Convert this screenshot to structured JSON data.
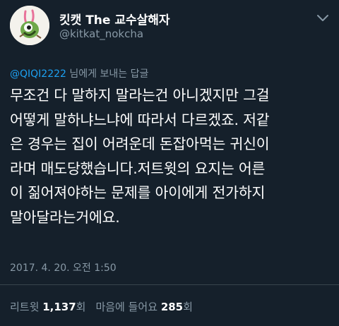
{
  "author": {
    "display_name": "킷캣 The 교수살해자",
    "handle": "@kitkat_nokcha",
    "avatar_icon": "bird-avatar"
  },
  "reply": {
    "mention": "@QIQI2222",
    "suffix": " 님에게 보내는 답글"
  },
  "tweet": {
    "text": "무조건 다 말하지 말라는건 아니겠지만 그걸\n어떻게 말하냐느냐에 따라서 다르겠죠. 저같\n은 경우는 집이 어려운데 돈잡아먹는 귀신이\n라며 매도당했습니다.저트윗의 요지는 어른\n이 짊어져야하는 문제를 아이에게 전가하지\n말아달라는거에요.",
    "timestamp": "2017. 4. 20. 오전 1:50"
  },
  "stats": {
    "retweets_label": "리트윗",
    "retweets_count": "1,137",
    "retweets_unit": "회",
    "likes_label": "마음에 들어요",
    "likes_count": "285",
    "likes_unit": "회"
  },
  "colors": {
    "background": "#15202b",
    "secondary_text": "#8899a6",
    "link": "#1da1f2",
    "divider": "#38444d"
  }
}
